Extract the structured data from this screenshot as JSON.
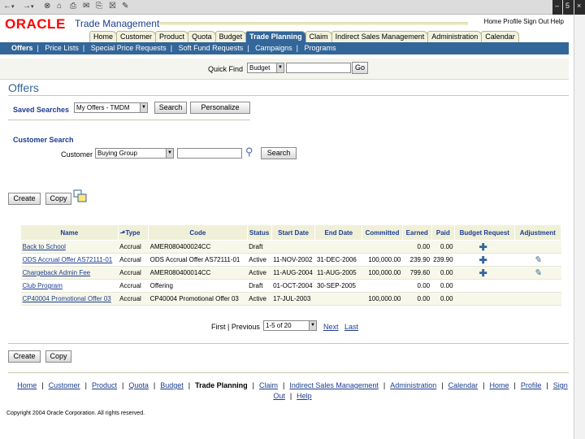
{
  "browser": {
    "toolbar_glyphs": [
      "←",
      "▾",
      "→",
      "▾",
      "⊗",
      "⌂",
      "⎙",
      "✉",
      "⎘",
      "☒",
      "✎"
    ],
    "window_controls": [
      "–",
      "5",
      "×"
    ]
  },
  "brand": {
    "logo": "ORACLE",
    "app": "Trade Management"
  },
  "global_links": [
    "Home",
    "Profile",
    "Sign Out",
    "Help"
  ],
  "tabs": [
    "Home",
    "Customer",
    "Product",
    "Quota",
    "Budget",
    "Trade Planning",
    "Claim",
    "Indirect Sales Management",
    "Administration",
    "Calendar"
  ],
  "active_tab": "Trade Planning",
  "subnav": [
    "Offers",
    "Price Lists",
    "Special Price Requests",
    "Soft Fund Requests",
    "Campaigns",
    "Programs"
  ],
  "quick_find": {
    "label": "Quick Find",
    "select_value": "Budget",
    "go": "Go"
  },
  "page_title": "Offers",
  "saved_searches": {
    "label": "Saved Searches",
    "value": "My Offers - TMDM",
    "search": "Search",
    "personalize": "Personalize"
  },
  "customer_search": {
    "heading": "Customer Search",
    "label": "Customer",
    "value": "Buying Group",
    "search": "Search"
  },
  "actions": {
    "create": "Create",
    "copy": "Copy"
  },
  "table": {
    "headers": [
      "Name",
      "Type",
      "Code",
      "Status",
      "Start Date",
      "End Date",
      "Committed",
      "Earned",
      "Paid",
      "Budget Request",
      "Adjustment"
    ],
    "rows": [
      {
        "name": "Back to School",
        "type": "Accrual",
        "code": "AMER080400024CC",
        "status": "Draft",
        "start": "",
        "end": "",
        "committed": "",
        "earned": "0.00",
        "paid": "0.00",
        "budget": true,
        "adjust": false
      },
      {
        "name": "ODS Accrual Offer AS72111-01",
        "type": "Accrual",
        "code": "ODS Accrual Offer AS72111-01",
        "status": "Active",
        "start": "11-NOV-2002",
        "end": "31-DEC-2006",
        "committed": "100,000.00",
        "earned": "239.90",
        "paid": "239.90",
        "budget": true,
        "adjust": true
      },
      {
        "name": "Chargeback Admin Fee",
        "type": "Accrual",
        "code": "AMER080400014CC",
        "status": "Active",
        "start": "11-AUG-2004",
        "end": "11-AUG-2005",
        "committed": "100,000.00",
        "earned": "799.60",
        "paid": "0.00",
        "budget": true,
        "adjust": true
      },
      {
        "name": "Club Program",
        "type": "Accrual",
        "code": "Offering",
        "status": "Draft",
        "start": "01-OCT-2004",
        "end": "30-SEP-2005",
        "committed": "",
        "earned": "0.00",
        "paid": "0.00",
        "budget": false,
        "adjust": false
      },
      {
        "name": "CP40004 Promotional Offer 03",
        "type": "Accrual",
        "code": "CP40004 Promotional Offer 03",
        "status": "Active",
        "start": "17-JUL-2003",
        "end": "",
        "committed": "100,000.00",
        "earned": "0.00",
        "paid": "0.00",
        "budget": false,
        "adjust": false
      }
    ]
  },
  "pagination": {
    "first": "First",
    "previous": "Previous",
    "range": "1-5 of 20",
    "next": "Next",
    "last": "Last"
  },
  "footer_links": [
    "Home",
    "Customer",
    "Product",
    "Quota",
    "Budget",
    "Trade Planning",
    "Claim",
    "Indirect Sales Management",
    "Administration",
    "Calendar",
    "Home",
    "Profile",
    "Sign Out",
    "Help"
  ],
  "copyright": "Copyright 2004 Oracle Corporation. All rights reserved."
}
